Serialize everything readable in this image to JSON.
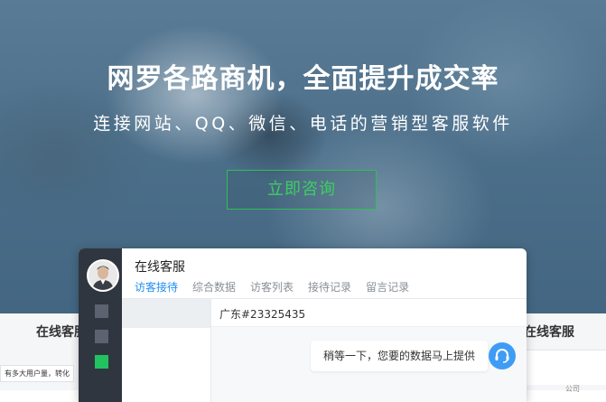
{
  "hero": {
    "title": "网罗各路商机，全面提升成交率",
    "subtitle": "连接网站、QQ、微信、电话的营销型客服软件",
    "cta_label": "立即咨询"
  },
  "side_cards": {
    "left_title": "在线客服",
    "left_text": "有多大用户量，转化",
    "right_title": "在线客服",
    "right_small": "公司"
  },
  "chat": {
    "title": "在线客服",
    "tabs": [
      {
        "label": "访客接待",
        "active": true
      },
      {
        "label": "综合数据",
        "active": false
      },
      {
        "label": "访客列表",
        "active": false
      },
      {
        "label": "接待记录",
        "active": false
      },
      {
        "label": "留言记录",
        "active": false
      }
    ],
    "visitor_id": "广东#23325435",
    "message": "稍等一下，您要的数据马上提供"
  },
  "colors": {
    "accent_blue": "#1f8ef1",
    "cta_green": "#3ccf62",
    "sidebar_dark": "#2f3640",
    "active_green": "#22c35e"
  },
  "icons": {
    "avatar": "agent-avatar",
    "agent": "headset-icon"
  }
}
